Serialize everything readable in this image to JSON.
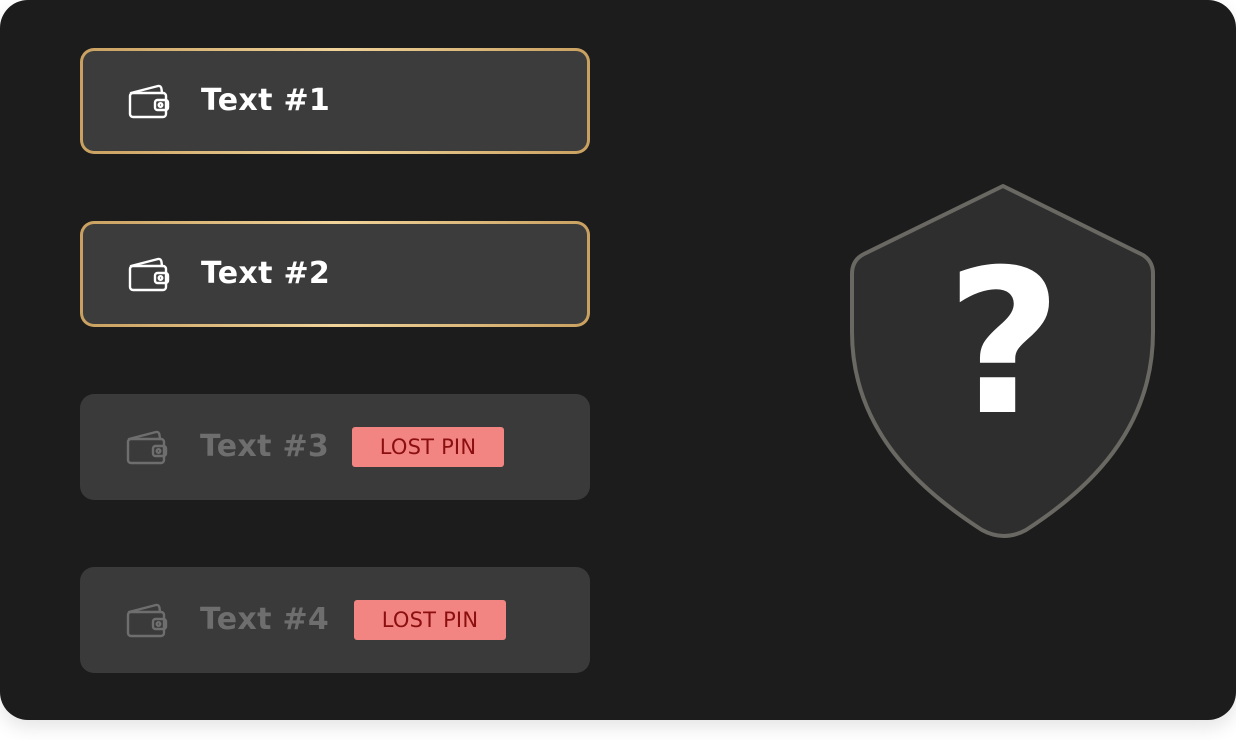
{
  "wallets": [
    {
      "label": "Text #1",
      "icon": "wallet-icon",
      "state": "active"
    },
    {
      "label": "Text #2",
      "icon": "wallet-icon",
      "state": "active"
    },
    {
      "label": "Text #3",
      "icon": "wallet-icon",
      "state": "inactive",
      "badge": "LOST PIN"
    },
    {
      "label": "Text #4",
      "icon": "wallet-icon",
      "state": "inactive",
      "badge": "LOST PIN"
    }
  ],
  "security": {
    "icon": "shield-question-icon",
    "symbol": "?"
  },
  "colors": {
    "background": "#1c1c1c",
    "card": "#3d3d3d",
    "gold_border": "#d8b06a",
    "badge_bg": "#f28482",
    "badge_text": "#8b0f0f",
    "shield_outline": "#6a6862",
    "shield_fill": "#2e2e2e"
  }
}
